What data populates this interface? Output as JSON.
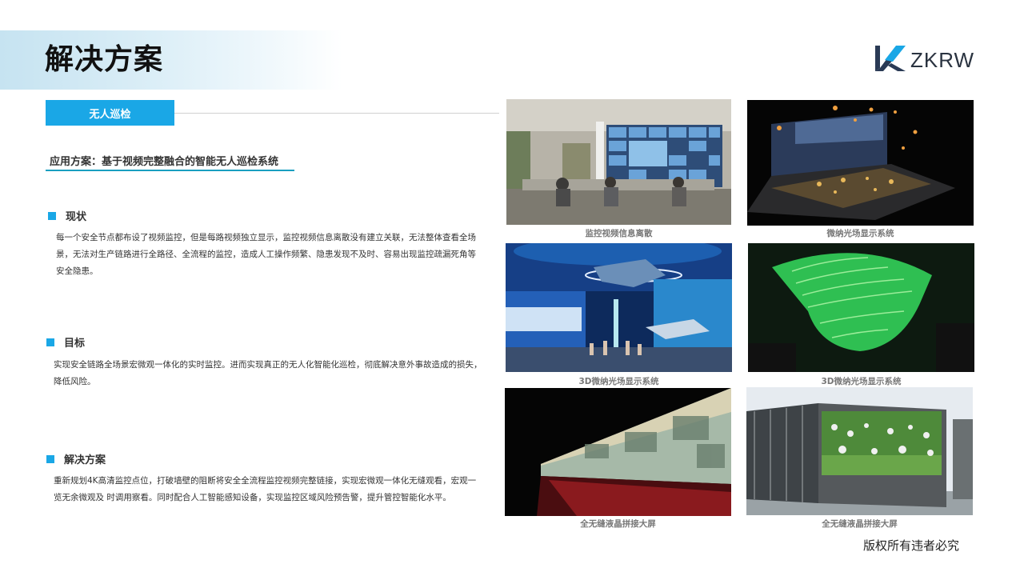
{
  "header": {
    "title": "解决方案"
  },
  "logo": {
    "text": "ZKRW"
  },
  "section": {
    "tab_label": "无人巡检",
    "app_scheme": "应用方案：基于视频完整融合的智能无人巡检系统"
  },
  "blocks": {
    "status": {
      "heading": "现状",
      "lines": [
        "每一个安全节点都布设了视频监控，但是每路视频独立显示，监控视频信息离散没有建立关联，无法整体查看全场",
        "景，无法对生产链路进行全路径、全流程的监控，造成人工操作频繁、隐患发现不及时、容易出现监控疏漏死角等",
        "安全隐患。"
      ]
    },
    "goal": {
      "heading": "目标",
      "lines": [
        "实现安全链路全场景宏微观一体化的实时监控。进而实现真正的无人化智能化巡检，彻底解决意外事故造成的损失，",
        "降低风险。"
      ]
    },
    "solution": {
      "heading": "解决方案",
      "lines": [
        "重新规划4K高清监控点位，打破墙壁的阻断将安全全流程监控视频完整链接，实现宏微观一体化无缝观看，宏观一",
        "览无余微观及 时调用察看。同时配合人工智能感知设备，实现监控区域风险预告警，提升管控智能化水平。"
      ]
    }
  },
  "gallery": {
    "captions": [
      "监控视频信息离散",
      "微纳光场显示系统",
      "3D微纳光场显示系统",
      "3D微纳光场显示系统",
      "全无缝液晶拼接大屏",
      "全无缝液晶拼接大屏"
    ]
  },
  "footer": {
    "copyright": "版权所有违者必究"
  },
  "colors": {
    "accent": "#1aa7e6",
    "rule": "#1a9fc0",
    "title_band": "#c6e3f1"
  }
}
